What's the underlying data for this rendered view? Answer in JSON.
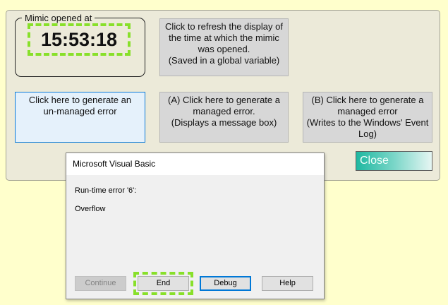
{
  "mimic": {
    "time_group_label": "Mimic opened at",
    "time_value": "15:53:18",
    "refresh_button": "Click to refresh the display of\nthe time at which the mimic\nwas opened.\n (Saved in a global variable)",
    "unmanaged_button": "Click here to generate an\nun-managed error",
    "managed_a_button": "(A) Click here to generate a\nmanaged error.\n(Displays a message box)",
    "managed_b_button": "(B) Click here to generate a\nmanaged error\n(Writes to the Windows' Event\nLog)",
    "close_button": "Close"
  },
  "dialog": {
    "title": "Microsoft Visual Basic",
    "error_text": "Run-time error '6':",
    "message": "Overflow",
    "buttons": {
      "continue": "Continue",
      "end": "End",
      "debug": "Debug",
      "help": "Help"
    }
  },
  "colors": {
    "background": "#ffffcc",
    "panel": "#ecead9",
    "highlight": "#88e02a",
    "focus_blue": "#0078d7",
    "close_gradient_start": "#1fb8a1"
  }
}
